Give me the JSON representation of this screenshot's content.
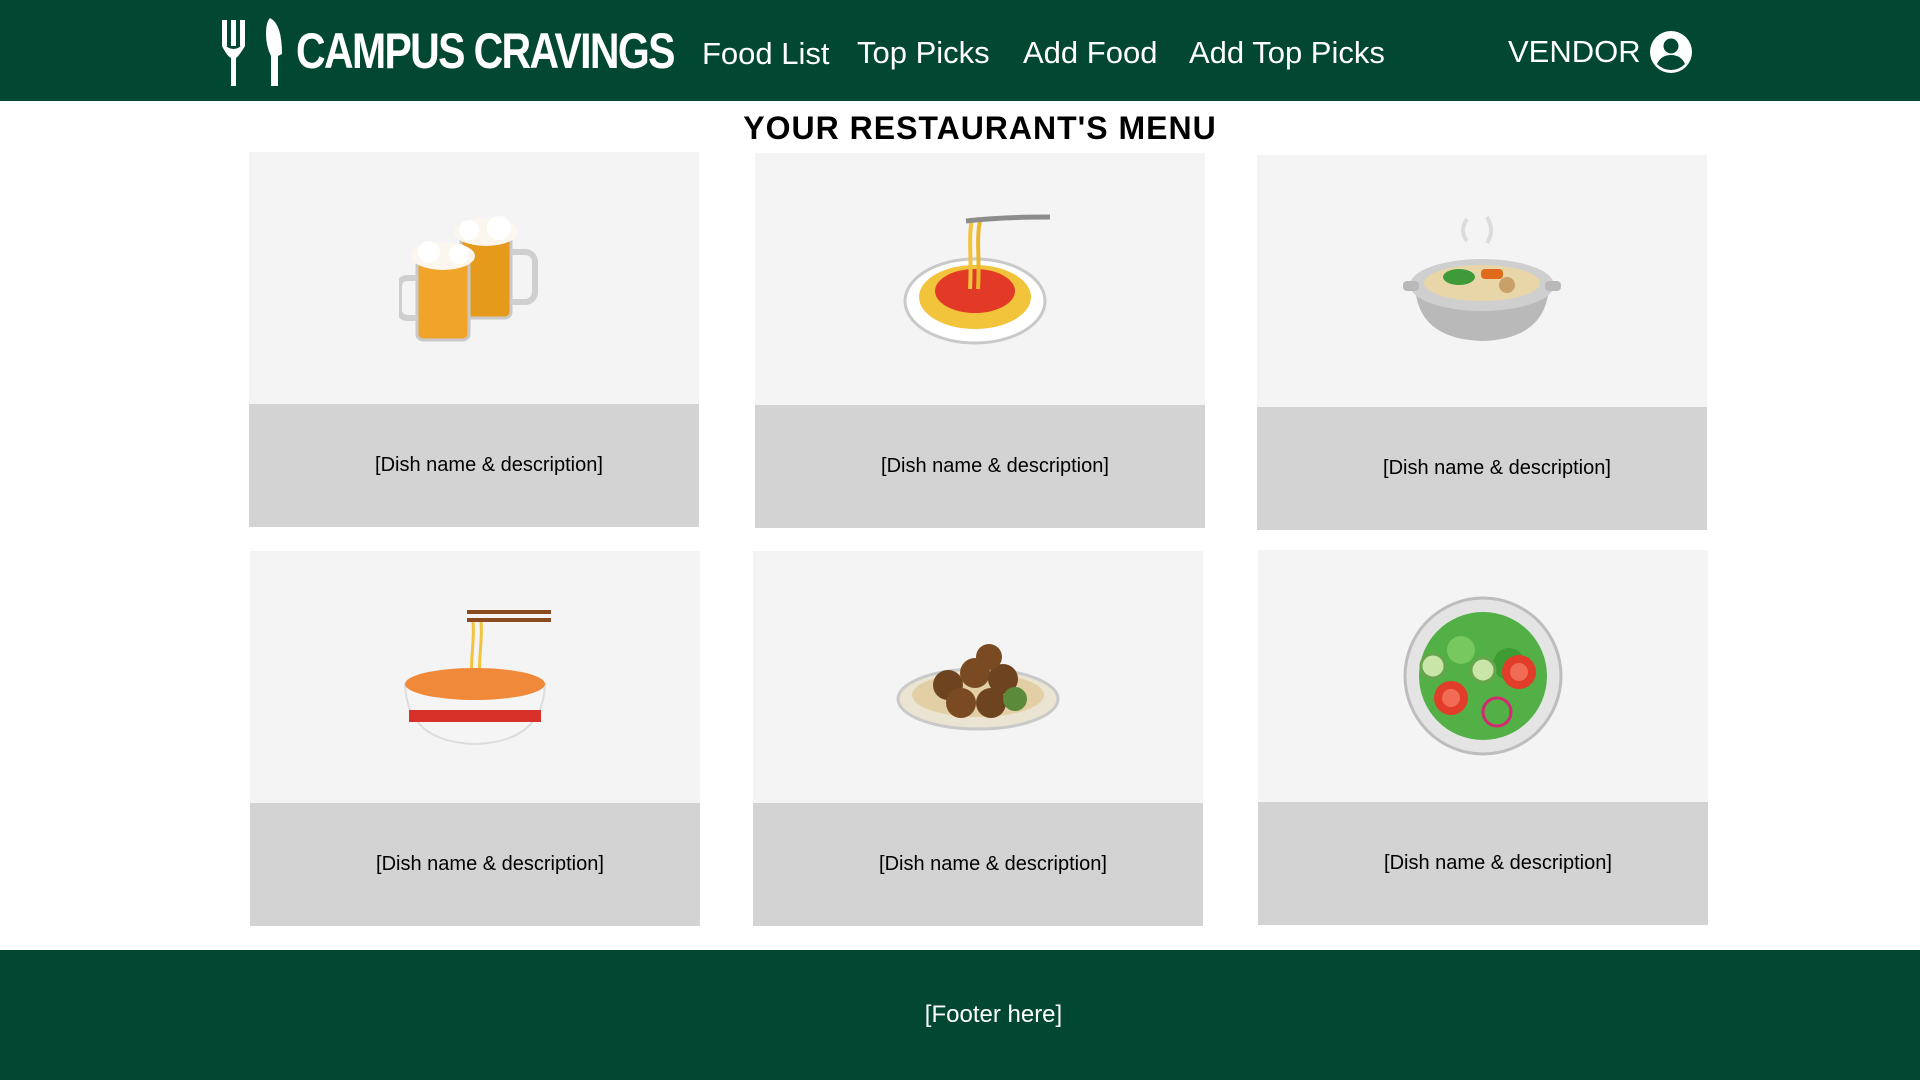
{
  "header": {
    "logo_icon": "fork-knife-icon",
    "brand": "CAMPUS CRAVINGS",
    "nav": [
      {
        "label": "Food List"
      },
      {
        "label": "Top Picks"
      },
      {
        "label": "Add Food"
      },
      {
        "label": "Add Top Picks"
      }
    ],
    "account": {
      "label": "VENDOR",
      "icon": "user-circle-icon"
    }
  },
  "main": {
    "title": "YOUR RESTAURANT'S MENU",
    "cards": [
      {
        "icon": "beer-mugs-icon",
        "caption": "[Dish name & description]"
      },
      {
        "icon": "spaghetti-icon",
        "caption": "[Dish name & description]"
      },
      {
        "icon": "stew-pot-icon",
        "caption": "[Dish name & description]"
      },
      {
        "icon": "ramen-bowl-icon",
        "caption": "[Dish name & description]"
      },
      {
        "icon": "falafel-icon",
        "caption": "[Dish name & description]"
      },
      {
        "icon": "green-salad-icon",
        "caption": "[Dish name & description]"
      }
    ]
  },
  "footer": {
    "text": "[Footer here]"
  },
  "colors": {
    "brand_green": "#024731",
    "card_top": "#f4f4f4",
    "card_caption": "#d3d3d3"
  }
}
